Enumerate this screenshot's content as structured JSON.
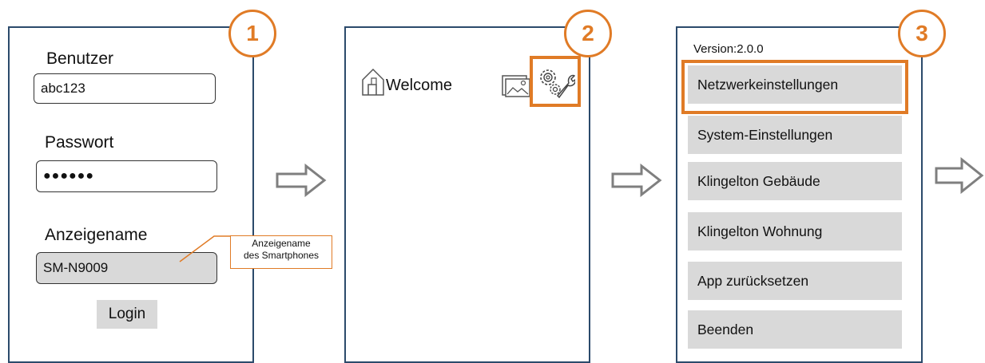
{
  "colors": {
    "accent": "#e07b26",
    "panel_border": "#2b4a6b",
    "field_gray": "#d9d9d9"
  },
  "step1": {
    "badge": "1",
    "user_label": "Benutzer",
    "user_value": "abc123",
    "password_label": "Passwort",
    "password_value": "●●●●●●",
    "display_name_label": "Anzeigename",
    "display_name_value": "SM-N9009",
    "login_label": "Login",
    "callout_line1": "Anzeigename",
    "callout_line2": "des Smartphones"
  },
  "step2": {
    "badge": "2",
    "welcome": "Welcome",
    "icons": [
      "home-icon",
      "image-icon",
      "settings-icon"
    ]
  },
  "step3": {
    "badge": "3",
    "version": "Version:2.0.0",
    "menu": [
      "Netzwerkeinstellungen",
      "System-Einstellungen",
      "Klingelton Gebäude",
      "Klingelton Wohnung",
      "App zurücksetzen",
      "Beenden"
    ]
  },
  "arrows": [
    "arrow-right-icon",
    "arrow-right-icon",
    "arrow-right-icon"
  ]
}
